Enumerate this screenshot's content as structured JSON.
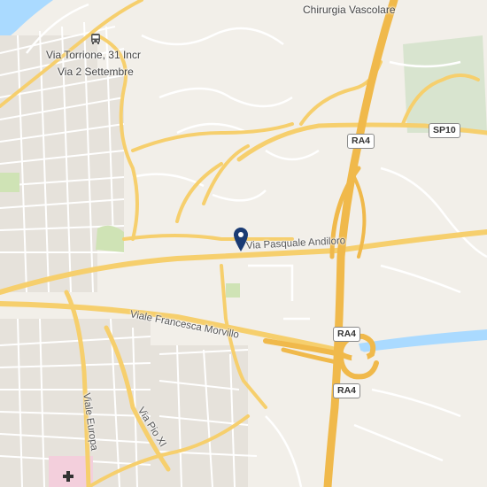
{
  "map": {
    "colors": {
      "background": "#f2efe9",
      "block": "#e6e2db",
      "minor_road": "#ffffff",
      "major_road": "#f6cf6d",
      "highway": "#f0b94b",
      "water": "#aadaff",
      "park": "#cfe3b5",
      "hospital": "#f3cfdc",
      "marker": "#1a3b73"
    },
    "labels": {
      "hospital_poi": "Chirurgia Vascolare",
      "bus_stop_line1": "Via Torrione, 31 Incr",
      "bus_stop_line2": "Via 2 Settembre",
      "road_andiloro": "Via Pasquale Andiloro",
      "road_morvillo": "Viale Francesca Morvillo",
      "road_europa": "Viale Europa",
      "road_pio": "Via Pio XI"
    },
    "shields": {
      "ra4_top": "RA4",
      "sp10": "SP10",
      "ra4_mid": "RA4",
      "ra4_bottom": "RA4"
    },
    "icons": {
      "bus": "bus-icon",
      "marker": "location-pin-icon",
      "hospital": "hospital-cross-icon"
    }
  }
}
